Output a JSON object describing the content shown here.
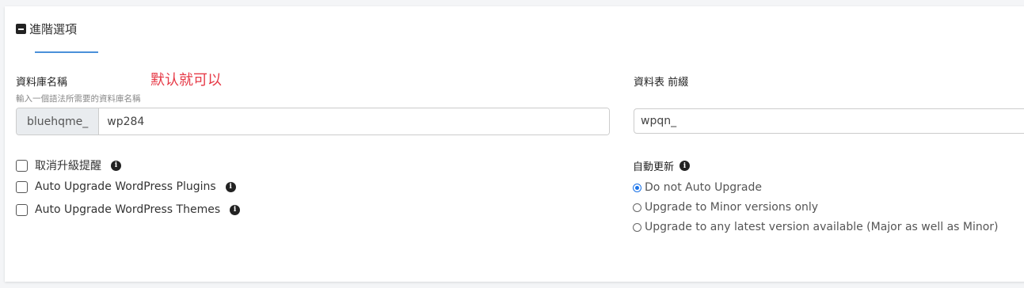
{
  "section": {
    "title": "進階選項"
  },
  "db": {
    "label": "資料庫名稱",
    "hint": "輸入一個語法所需要的資料庫名稱",
    "annotation": "默认就可以",
    "prefix": "bluehqme_",
    "value": "wp284"
  },
  "table_prefix": {
    "label": "資料表 前綴",
    "value": "wpqn_"
  },
  "options": [
    {
      "label": "取消升級提醒",
      "checked": false
    },
    {
      "label": "Auto Upgrade WordPress Plugins",
      "checked": false
    },
    {
      "label": "Auto Upgrade WordPress Themes",
      "checked": false
    }
  ],
  "auto_update": {
    "label": "自動更新",
    "choices": [
      {
        "label": "Do not Auto Upgrade",
        "selected": true
      },
      {
        "label": "Upgrade to Minor versions only",
        "selected": false
      },
      {
        "label": "Upgrade to any latest version available (Major as well as Minor)",
        "selected": false
      }
    ]
  },
  "colors": {
    "accent": "#4a90d9",
    "annotation": "#e63946",
    "radio_selected": "#1a73e8"
  },
  "icons": {
    "collapse": "minus-square-icon",
    "info": "info-circle-icon"
  }
}
